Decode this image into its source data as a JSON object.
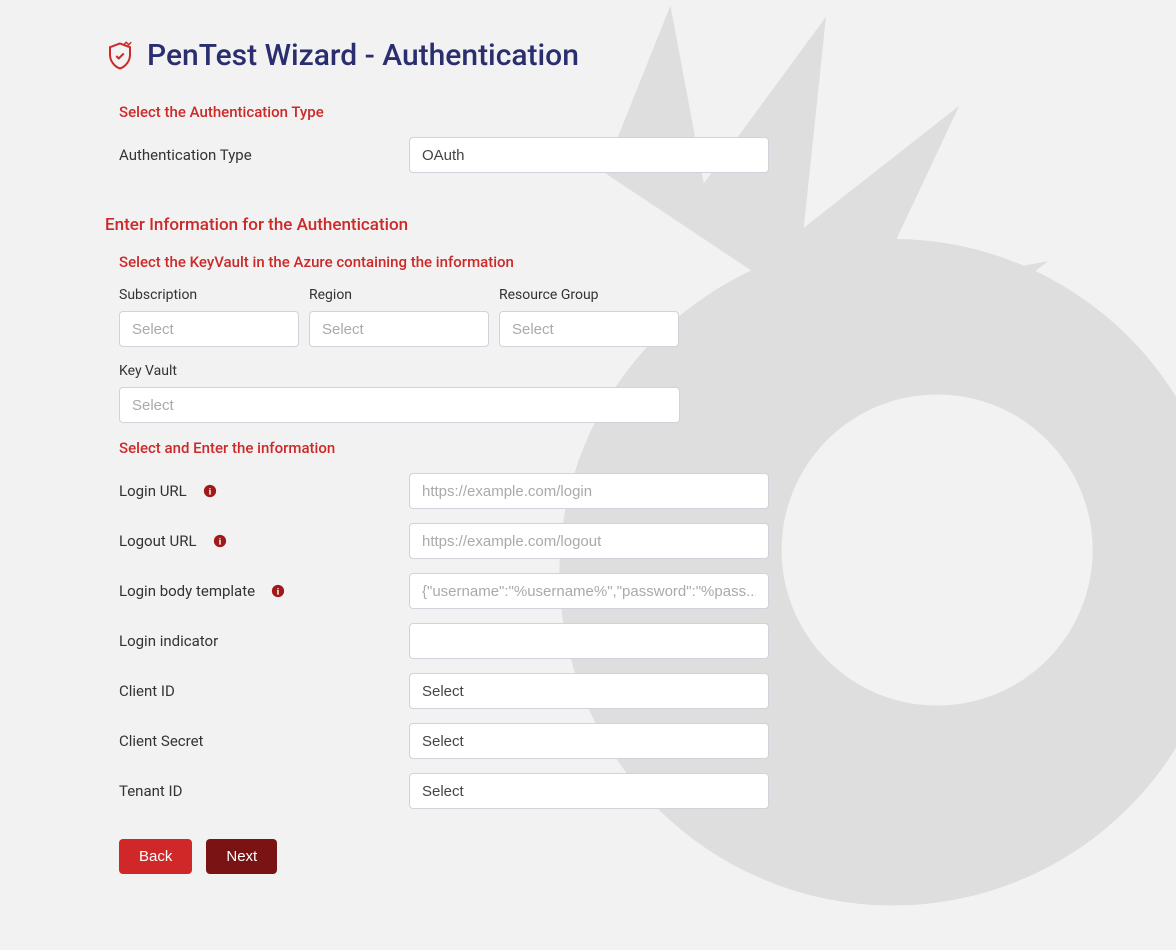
{
  "header": {
    "title": "PenTest Wizard - Authentication"
  },
  "section1": {
    "label": "Select the Authentication Type",
    "fieldLabel": "Authentication Type",
    "fieldValue": "OAuth"
  },
  "section2": {
    "heading": "Enter Information for the Authentication",
    "kvLabel": "Select the KeyVault in the Azure containing the information",
    "subscription": {
      "label": "Subscription",
      "placeholder": "Select"
    },
    "region": {
      "label": "Region",
      "placeholder": "Select"
    },
    "resourceGroup": {
      "label": "Resource Group",
      "placeholder": "Select"
    },
    "keyVault": {
      "label": "Key Vault",
      "placeholder": "Select"
    },
    "infoLabel": "Select and Enter the information",
    "loginUrl": {
      "label": "Login URL",
      "placeholder": "https://example.com/login"
    },
    "logoutUrl": {
      "label": "Logout URL",
      "placeholder": "https://example.com/logout"
    },
    "loginBody": {
      "label": "Login body template",
      "placeholder": "{\"username\":\"%username%\",\"password\":\"%pass..."
    },
    "loginIndicator": {
      "label": "Login indicator"
    },
    "clientId": {
      "label": "Client ID",
      "value": "Select"
    },
    "clientSecret": {
      "label": "Client Secret",
      "value": "Select"
    },
    "tenantId": {
      "label": "Tenant ID",
      "value": "Select"
    }
  },
  "buttons": {
    "back": "Back",
    "next": "Next"
  }
}
